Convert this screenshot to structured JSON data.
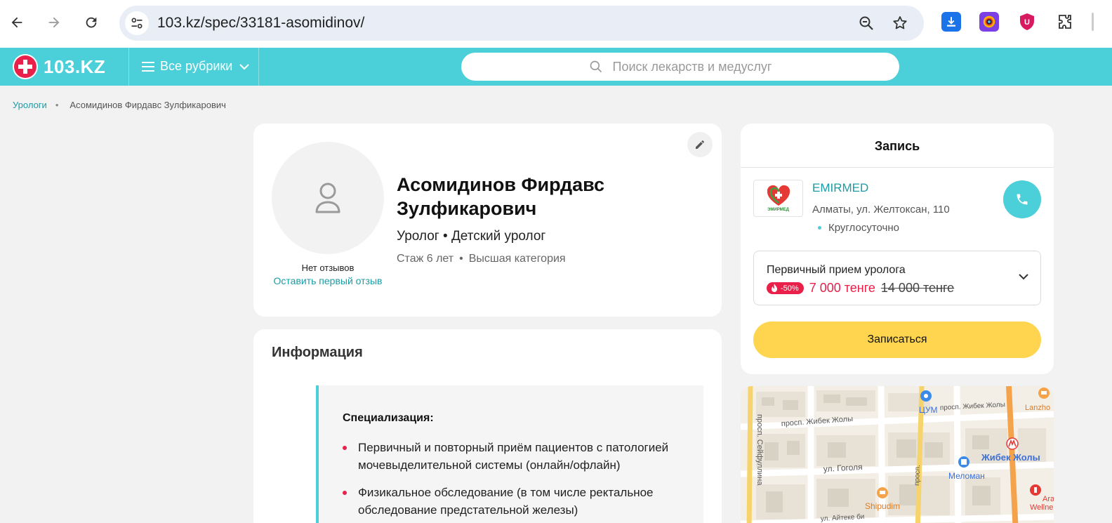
{
  "browser": {
    "url": "103.kz/spec/33181-asomidinov/"
  },
  "header": {
    "logo_text": "103.KZ",
    "rubrics_label": "Все рубрики",
    "search_placeholder": "Поиск лекарств и медуслуг"
  },
  "breadcrumb": {
    "items": [
      "Урологи",
      "Асомидинов Фирдавс Зулфикарович"
    ],
    "separator": "•"
  },
  "profile": {
    "name": "Асомидинов Фирдавс Зулфикарович",
    "specialty": "Уролог • Детский уролог",
    "experience": "Стаж 6 лет",
    "category": "Высшая категория",
    "meta_separator": "•",
    "reviews_none": "Нет отзывов",
    "leave_review": "Оставить первый отзыв"
  },
  "info": {
    "title": "Информация",
    "subtitle": "Специализация:",
    "items": [
      "Первичный и повторный приём пациентов с патологией мочевыделительной системы (онлайн/офлайн)",
      "Физикальное обследование (в том числе ректальное обследование предстательной железы)"
    ]
  },
  "booking": {
    "title": "Запись",
    "clinic_name": "EMIRMED",
    "clinic_logo_text": "ЭМИРМЕД",
    "clinic_address": "Алматы, ул. Желтоксан, 110",
    "clinic_hours": "Круглосуточно",
    "service_name": "Первичный прием уролога",
    "discount": "-50%",
    "price_new": "7 000 тенге",
    "price_old": "14 000 тенге",
    "book_label": "Записаться"
  },
  "map": {
    "labels": {
      "zhibek_1": "просп. Жибек Жолы",
      "zhibek_2": "просп. Жибек Жолы",
      "seifullin": "просп. Сейфуллина",
      "gogol": "ул. Гоголя",
      "tsum": "ЦУМ",
      "metro": "Жибек Жолы",
      "meloman": "Меломан",
      "shipudim": "Shipudim",
      "lanzhou": "Lanzho",
      "wellness_1": "Ara",
      "wellness_2": "Wellne",
      "aiteke": "ул. Айтеке би",
      "prosp_short": "просп."
    }
  },
  "colors": {
    "brand": "#4bcfd8",
    "link": "#1a9ca6",
    "accent_red": "#e8204a",
    "book_yellow": "#ffd54f"
  }
}
